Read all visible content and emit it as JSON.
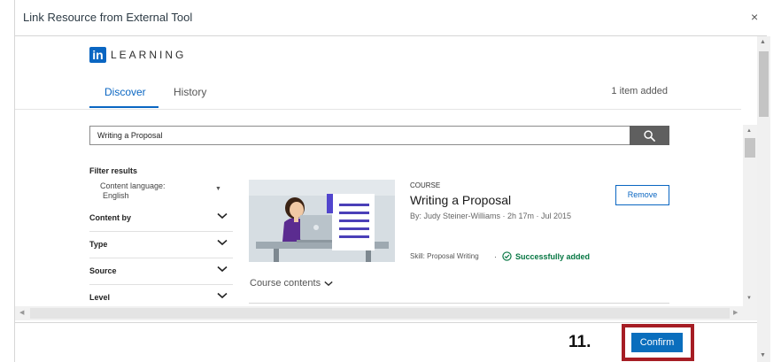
{
  "dialog": {
    "title": "Link Resource from External Tool",
    "close_glyph": "×"
  },
  "brand": {
    "logo_in": "in",
    "logo_text": "LEARNING",
    "accent_color": "#0a66c2"
  },
  "tabs": [
    {
      "label": "Discover",
      "active": true
    },
    {
      "label": "History",
      "active": false
    }
  ],
  "status": {
    "items_added": "1 item added"
  },
  "search": {
    "value": "Writing a Proposal",
    "button_icon": "search-icon"
  },
  "filters": {
    "title": "Filter results",
    "content_language_label": "Content language:",
    "content_language_value": "English",
    "groups": [
      {
        "label": "Content by"
      },
      {
        "label": "Type"
      },
      {
        "label": "Source"
      },
      {
        "label": "Level"
      }
    ]
  },
  "course": {
    "kind": "COURSE",
    "title": "Writing a Proposal",
    "meta": "By: Judy Steiner-Williams  ·  2h 17m  ·  Jul 2015",
    "skill": "Skill: Proposal Writing",
    "status": "Successfully added",
    "status_color": "#057642",
    "remove_label": "Remove",
    "contents_label": "Course contents"
  },
  "footer": {
    "step_label": "11.",
    "confirm_label": "Confirm",
    "highlight_color": "#a61d24"
  }
}
